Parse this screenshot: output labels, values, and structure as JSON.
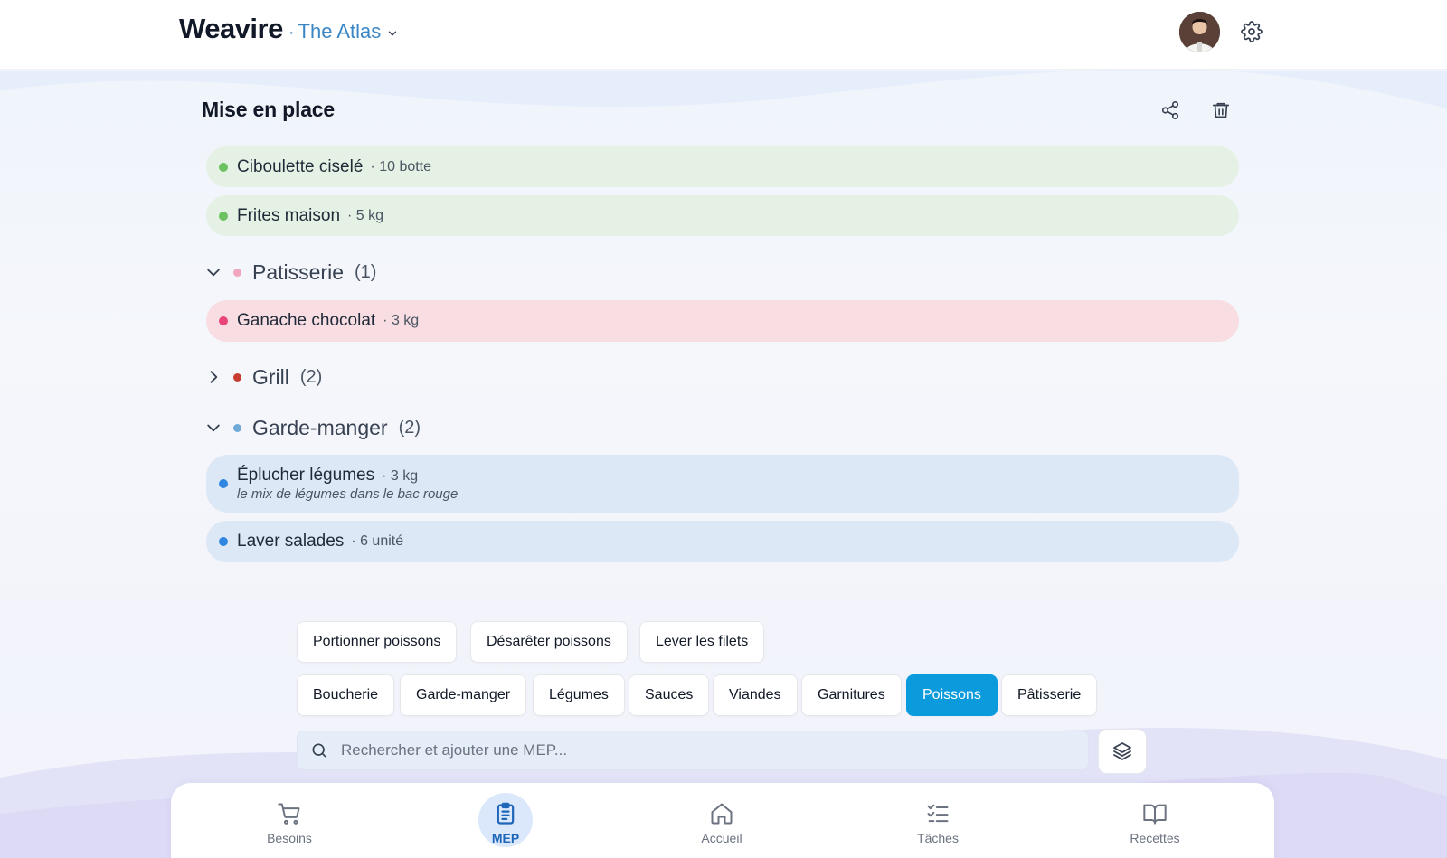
{
  "header": {
    "brand": "Weavire",
    "separator": "·",
    "workspace": "The Atlas"
  },
  "page": {
    "title": "Mise en place"
  },
  "items_top": [
    {
      "name": "Ciboulette ciselé",
      "qty": "· 10 botte",
      "color": "#6cc160"
    },
    {
      "name": "Frites maison",
      "qty": "· 5 kg",
      "color": "#6cc160"
    }
  ],
  "groups": [
    {
      "name": "Patisserie",
      "count": "(1)",
      "expanded": true,
      "dot_color": "#f0a6bd",
      "items": [
        {
          "name": "Ganache chocolat",
          "qty": "· 3 kg",
          "color": "#e9457a"
        }
      ]
    },
    {
      "name": "Grill",
      "count": "(2)",
      "expanded": false,
      "dot_color": "#c83b2f",
      "items": []
    },
    {
      "name": "Garde-manger",
      "count": "(2)",
      "expanded": true,
      "dot_color": "#6ea9d8",
      "items": [
        {
          "name": "Éplucher légumes",
          "qty": "· 3 kg",
          "note": "le mix de légumes dans le bac rouge",
          "color": "#2f86e0"
        },
        {
          "name": "Laver salades",
          "qty": "· 6 unité",
          "color": "#2f86e0"
        }
      ]
    }
  ],
  "suggestions": [
    "Portionner poissons",
    "Désarêter poissons",
    "Lever les filets"
  ],
  "categories": [
    "Boucherie",
    "Garde-manger",
    "Légumes",
    "Sauces",
    "Viandes",
    "Garnitures",
    "Poissons",
    "Pâtisserie"
  ],
  "active_category": "Poissons",
  "search": {
    "placeholder": "Rechercher et ajouter une MEP..."
  },
  "nav": [
    {
      "label": "Besoins",
      "icon": "cart-icon",
      "active": false
    },
    {
      "label": "MEP",
      "icon": "clipboard-icon",
      "active": true
    },
    {
      "label": "Accueil",
      "icon": "home-icon",
      "active": false
    },
    {
      "label": "Tâches",
      "icon": "checklist-icon",
      "active": false
    },
    {
      "label": "Recettes",
      "icon": "book-icon",
      "active": false
    }
  ],
  "colors": {
    "accent": "#0b9bdc",
    "brand_blue": "#3a86c4",
    "nav_active": "#1e66b8"
  }
}
